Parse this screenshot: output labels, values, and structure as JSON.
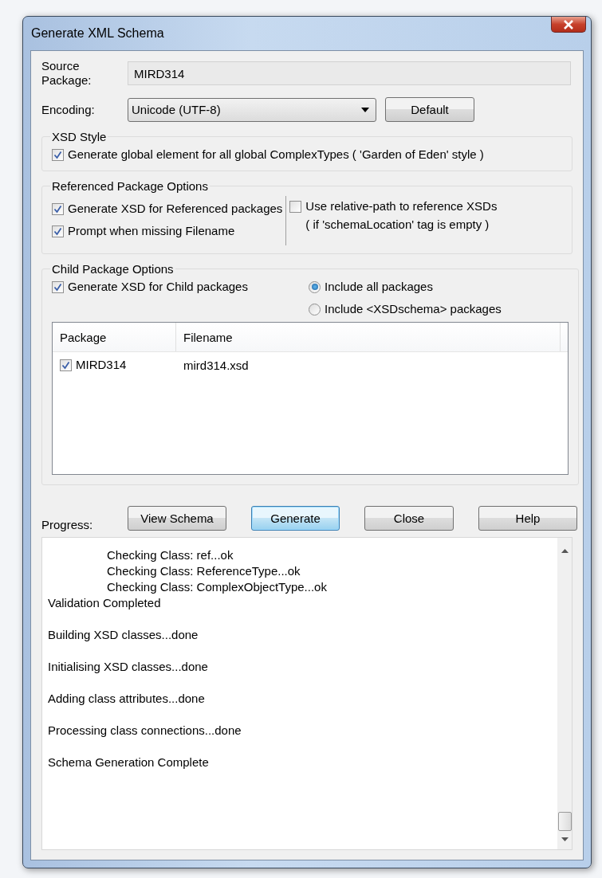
{
  "window": {
    "title": "Generate XML Schema"
  },
  "source_package": {
    "label": "Source\nPackage:",
    "value": "MIRD314"
  },
  "encoding": {
    "label": "Encoding:",
    "value": "Unicode (UTF-8)",
    "default_button": "Default"
  },
  "xsd_style": {
    "title": "XSD Style",
    "options": [
      {
        "label": "Generate global element for all global ComplexTypes ( 'Garden of Eden' style )",
        "checked": true
      }
    ]
  },
  "referenced_package_options": {
    "title": "Referenced Package Options",
    "left_options": [
      {
        "label": "Generate XSD for Referenced packages",
        "checked": true
      },
      {
        "label": "Prompt when missing Filename",
        "checked": true
      }
    ],
    "right_option": {
      "label": "Use relative-path to reference XSDs",
      "note": "( if 'schemaLocation' tag is empty )",
      "checked": false
    }
  },
  "child_package_options": {
    "title": "Child Package Options",
    "generate": {
      "label": "Generate XSD for Child packages",
      "checked": true
    },
    "radios": [
      {
        "label": "Include all packages",
        "selected": true
      },
      {
        "label": "Include <XSDschema> packages",
        "selected": false
      }
    ],
    "table": {
      "columns": [
        "Package",
        "Filename"
      ],
      "rows": [
        {
          "package": "MIRD314",
          "filename": "mird314.xsd",
          "checked": true
        }
      ]
    }
  },
  "buttons": [
    {
      "label": "View Schema",
      "focused": false
    },
    {
      "label": "Generate",
      "focused": true
    },
    {
      "label": "Close",
      "focused": false
    },
    {
      "label": "Help",
      "focused": false
    }
  ],
  "progress": {
    "label": "Progress:",
    "lines": [
      {
        "text": "Checking Class: ref...ok",
        "kind": "detail"
      },
      {
        "text": "Checking Class: ReferenceType...ok",
        "kind": "detail"
      },
      {
        "text": "Checking Class: ComplexObjectType...ok",
        "kind": "detail"
      },
      {
        "text": "Validation Completed",
        "kind": "step"
      },
      {
        "text": "Building XSD classes...done",
        "kind": "step"
      },
      {
        "text": "Initialising XSD classes...done",
        "kind": "step"
      },
      {
        "text": "Adding class attributes...done",
        "kind": "step"
      },
      {
        "text": "Processing class connections...done",
        "kind": "step"
      },
      {
        "text": "Schema Generation Complete",
        "kind": "step"
      }
    ]
  }
}
